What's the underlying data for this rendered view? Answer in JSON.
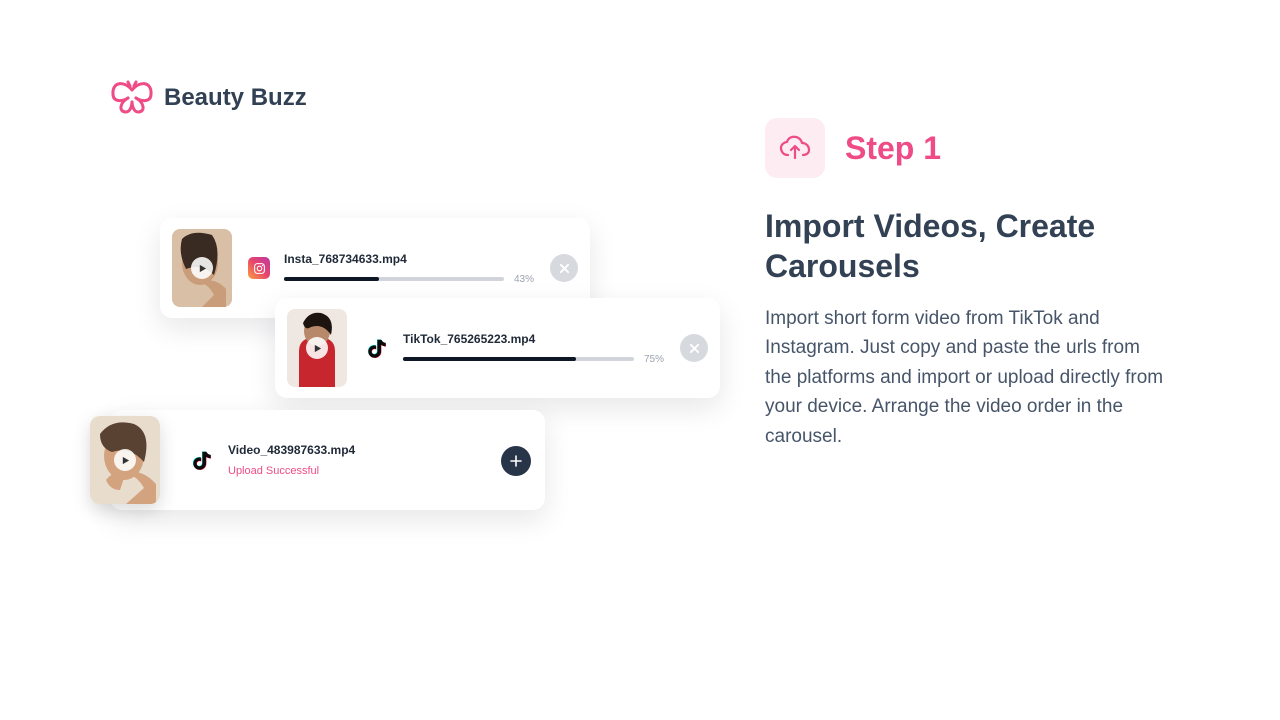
{
  "brand": {
    "name": "Beauty Buzz"
  },
  "step": {
    "label": "Step 1",
    "heading": "Import Videos, Create Carousels",
    "body": "Import short form video from TikTok and Instagram. Just copy and paste the urls from the platforms and import or upload directly from your device. Arrange the video order in the carousel."
  },
  "uploads": [
    {
      "source": "instagram",
      "filename": "Insta_768734633.mp4",
      "progress": 43,
      "progress_label": "43%"
    },
    {
      "source": "tiktok",
      "filename": "TikTok_765265223.mp4",
      "progress": 75,
      "progress_label": "75%"
    },
    {
      "source": "tiktok",
      "filename": "Video_483987633.mp4",
      "status": "Upload Successful"
    }
  ]
}
